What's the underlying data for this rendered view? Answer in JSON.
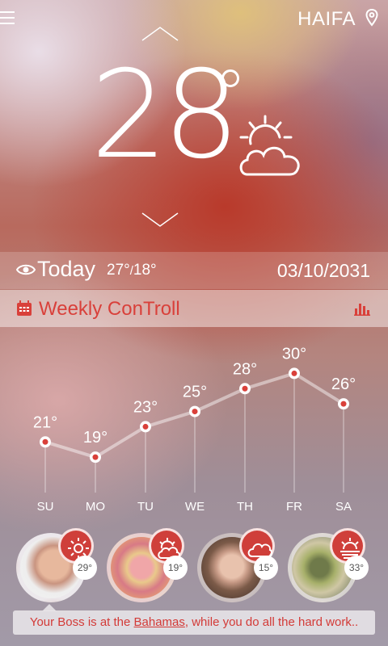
{
  "header": {
    "city": "HAIFA"
  },
  "current": {
    "temperature": "28",
    "condition_icon": "partly-cloudy-icon"
  },
  "today": {
    "label": "Today",
    "high": "27°",
    "separator": "/",
    "low": "18°",
    "date": "03/10/2031"
  },
  "weekly": {
    "label": "Weekly ConTroll"
  },
  "chart_data": {
    "type": "line",
    "categories": [
      "SU",
      "MO",
      "TU",
      "WE",
      "TH",
      "FR",
      "SA"
    ],
    "values": [
      21,
      19,
      23,
      25,
      28,
      30,
      26
    ],
    "data_labels": [
      "21°",
      "19°",
      "23°",
      "25°",
      "28°",
      "30°",
      "26°"
    ],
    "ylim": [
      17,
      31
    ],
    "grid": false
  },
  "people": [
    {
      "temp": "29°",
      "icon": "sun-icon"
    },
    {
      "temp": "19°",
      "icon": "partly-cloudy-icon"
    },
    {
      "temp": "15°",
      "icon": "cloud-icon"
    },
    {
      "temp": "33°",
      "icon": "sunset-icon"
    }
  ],
  "message": {
    "prefix": "Your Boss is at the ",
    "place": "Bahamas",
    "suffix": ", while you do all the hard work.."
  },
  "colors": {
    "accent": "#d9403a",
    "badge": "#cf3f3a"
  }
}
